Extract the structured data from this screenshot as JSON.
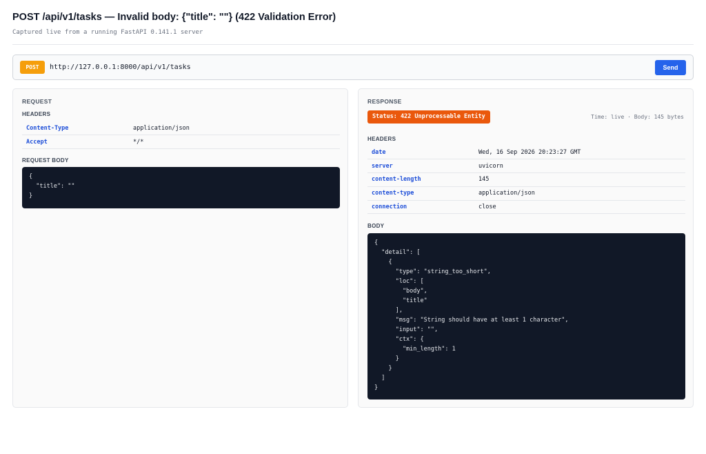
{
  "page": {
    "title": "POST /api/v1/tasks — Invalid body: {\"title\": \"\"} (422 Validation Error)",
    "subtitle": "Captured live from a running FastAPI 0.141.1 server"
  },
  "url_bar": {
    "method": "POST",
    "url": "http://127.0.0.1:8000/api/v1/tasks",
    "send_label": "Send",
    "method_color": "#f59e0b",
    "send_color": "#2563eb"
  },
  "request": {
    "section_label": "REQUEST",
    "headers_label": "HEADERS",
    "headers": [
      {
        "key": "Content-Type",
        "value": "application/json"
      },
      {
        "key": "Accept",
        "value": "*/*"
      }
    ],
    "body_label": "REQUEST BODY",
    "body": "{\n  \"title\": \"\"\n}"
  },
  "response": {
    "section_label": "RESPONSE",
    "status": "Status: 422 Unprocessable Entity",
    "status_color": "#ea580c",
    "meta": "Time: live · Body: 145 bytes",
    "headers_label": "HEADERS",
    "headers": [
      {
        "key": "date",
        "value": "Wed, 16 Sep 2026 20:23:27 GMT"
      },
      {
        "key": "server",
        "value": "uvicorn"
      },
      {
        "key": "content-length",
        "value": "145"
      },
      {
        "key": "content-type",
        "value": "application/json"
      },
      {
        "key": "connection",
        "value": "close"
      }
    ],
    "body_label": "BODY",
    "body": "{\n  \"detail\": [\n    {\n      \"type\": \"string_too_short\",\n      \"loc\": [\n        \"body\",\n        \"title\"\n      ],\n      \"msg\": \"String should have at least 1 character\",\n      \"input\": \"\",\n      \"ctx\": {\n        \"min_length\": 1\n      }\n    }\n  ]\n}"
  }
}
